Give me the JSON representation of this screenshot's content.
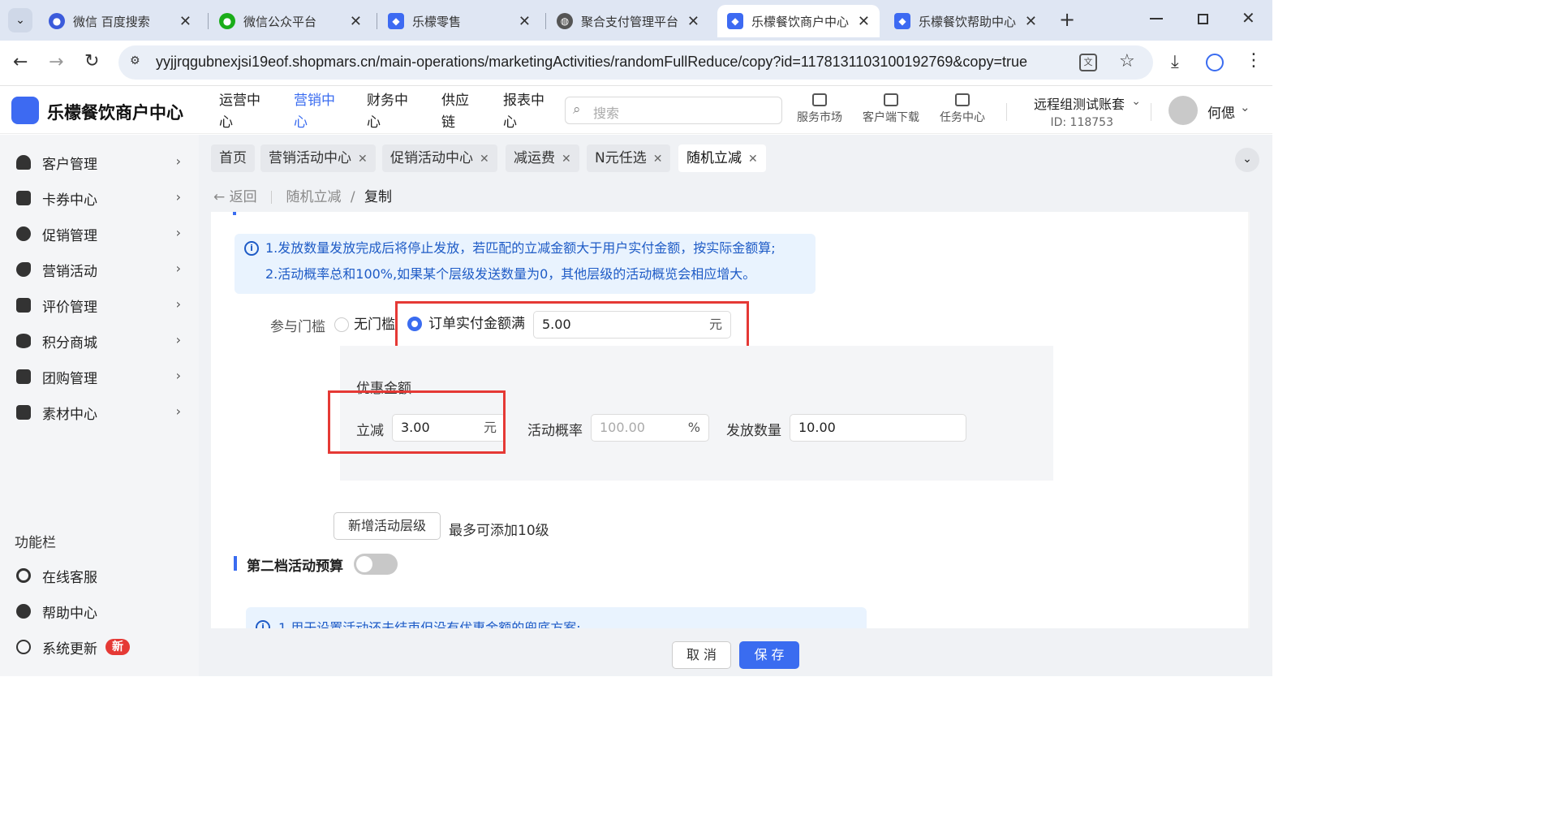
{
  "browser": {
    "tabs": [
      {
        "title": "微信 百度搜索"
      },
      {
        "title": "微信公众平台"
      },
      {
        "title": "乐檬零售"
      },
      {
        "title": "聚合支付管理平台"
      },
      {
        "title": "乐檬餐饮商户中心"
      },
      {
        "title": "乐檬餐饮帮助中心"
      }
    ],
    "url": "yyjjrqgubnexjsi19eof.shopmars.cn/main-operations/marketingActivities/randomFullReduce/copy?id=1178131103100192769&copy=true"
  },
  "header": {
    "brand": "乐檬餐饮商户中心",
    "nav": [
      "运营中心",
      "营销中心",
      "财务中心",
      "供应链",
      "报表中心"
    ],
    "search_placeholder": "搜索",
    "tools": [
      "服务市场",
      "客户端下载",
      "任务中心"
    ],
    "account_name": "远程组测试账套",
    "account_id": "ID: 118753",
    "user": "何偲"
  },
  "sidebar": {
    "items": [
      "客户管理",
      "卡券中心",
      "促销管理",
      "营销活动",
      "评价管理",
      "积分商城",
      "团购管理",
      "素材中心"
    ],
    "section_title": "功能栏",
    "bottom": [
      "在线客服",
      "帮助中心",
      "系统更新"
    ],
    "new_badge": "新"
  },
  "page_tabs": [
    "首页",
    "营销活动中心",
    "促销活动中心",
    "减运费",
    "N元任选",
    "随机立减"
  ],
  "breadcrumb": {
    "back": "返回",
    "parent": "随机立减",
    "sep": "/",
    "current": "复制"
  },
  "form": {
    "notice_line1": "1.发放数量发放完成后将停止发放，若匹配的立减金额大于用户实付金额，按实际金额算;",
    "notice_line2": "2.活动概率总和100%,如果某个层级发送数量为0，其他层级的活动概览会相应增大。",
    "threshold_label": "参与门槛",
    "opt_none": "无门槛",
    "opt_order": "订单实付金额满",
    "threshold_value": "5.00",
    "unit_yuan": "元",
    "discount_title": "优惠金额",
    "reduce_label": "立减",
    "reduce_value": "3.00",
    "prob_label": "活动概率",
    "prob_placeholder": "100.00",
    "unit_pct": "%",
    "qty_label": "发放数量",
    "qty_value": "10.00",
    "add_level": "新增活动层级",
    "add_level_hint": "最多可添加10级",
    "budget2_title": "第二档活动预算",
    "notice2": "1.用于设置活动还未结束但没有优惠金额的兜底方案;"
  },
  "footer": {
    "cancel": "取 消",
    "save": "保 存"
  },
  "colors": {
    "primary": "#3a6cf0",
    "highlight": "#e53935",
    "notice_bg": "#e9f3fe"
  }
}
